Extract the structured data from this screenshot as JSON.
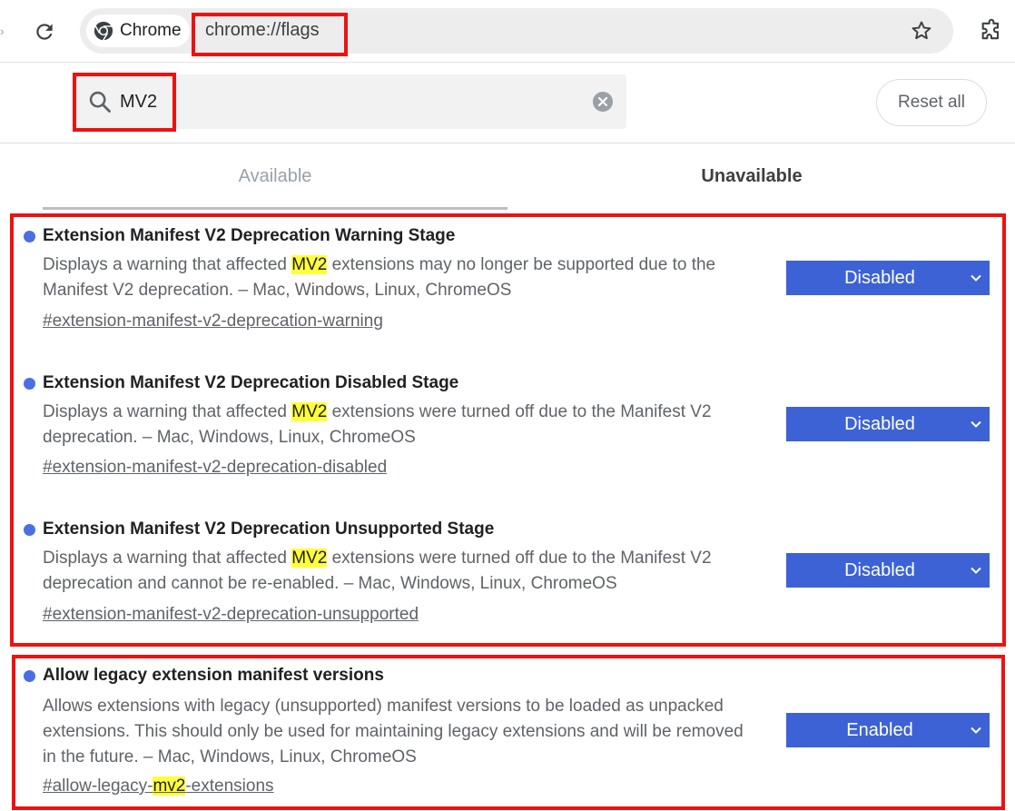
{
  "browser": {
    "chip_label": "Chrome",
    "url": "chrome://flags"
  },
  "search": {
    "value": "MV2",
    "placeholder": "Search flags"
  },
  "header": {
    "reset_label": "Reset all"
  },
  "tabs": [
    {
      "label": "Available"
    },
    {
      "label": "Unavailable"
    }
  ],
  "flags": [
    {
      "title": "Extension Manifest V2 Deprecation Warning Stage",
      "desc_before": "Displays a warning that affected ",
      "desc_highlight": "MV2",
      "desc_after": " extensions may no longer be supported due to the Manifest V2 deprecation. – Mac, Windows, Linux, ChromeOS",
      "link": "#extension-manifest-v2-deprecation-warning",
      "state": "Disabled"
    },
    {
      "title": "Extension Manifest V2 Deprecation Disabled Stage",
      "desc_before": "Displays a warning that affected ",
      "desc_highlight": "MV2",
      "desc_after": " extensions were turned off due to the Manifest V2 deprecation. – Mac, Windows, Linux, ChromeOS",
      "link": "#extension-manifest-v2-deprecation-disabled",
      "state": "Disabled"
    },
    {
      "title": "Extension Manifest V2 Deprecation Unsupported Stage",
      "desc_before": "Displays a warning that affected ",
      "desc_highlight": "MV2",
      "desc_after": " extensions were turned off due to the Manifest V2 deprecation and cannot be re-enabled. – Mac, Windows, Linux, ChromeOS",
      "link": "#extension-manifest-v2-deprecation-unsupported",
      "state": "Disabled"
    },
    {
      "title": "Allow legacy extension manifest versions",
      "desc": "Allows extensions with legacy (unsupported) manifest versions to be loaded as unpacked extensions. This should only be used for maintaining legacy extensions and will be removed in the future. – Mac, Windows, Linux, ChromeOS",
      "link_before": "#allow-legacy-",
      "link_highlight": "mv2",
      "link_after": "-extensions",
      "state": "Enabled"
    }
  ],
  "colors": {
    "accent": "#3c62d5",
    "dot": "#4a6fe3",
    "highlight": "#ffff3b",
    "annotation": "#ee1111"
  }
}
